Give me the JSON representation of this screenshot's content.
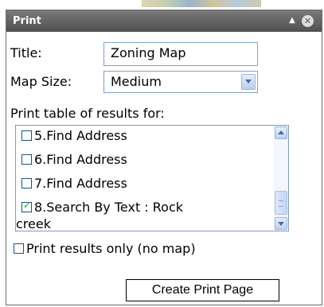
{
  "window": {
    "title": "Print"
  },
  "form": {
    "title_label": "Title:",
    "title_value": "Zoning Map",
    "map_size_label": "Map Size:",
    "map_size_value": "Medium",
    "print_table_label": "Print table of results for:"
  },
  "results_list": {
    "items": [
      {
        "label": "5.Find Address",
        "checked": false
      },
      {
        "label": "6.Find Address",
        "checked": false
      },
      {
        "label": "7.Find Address",
        "checked": false
      },
      {
        "label": "8.Search By Text : Rock",
        "label_cont": "creek",
        "checked": true
      }
    ]
  },
  "options": {
    "print_results_only_label": "Print results only (no map)",
    "print_results_only_checked": false
  },
  "actions": {
    "create_print_page_label": "Create Print Page"
  },
  "icons": {
    "collapse": "collapse-icon",
    "close": "close-icon",
    "dropdown": "chevron-down-icon",
    "scroll_up": "scroll-up-icon",
    "scroll_down": "scroll-down-icon"
  },
  "colors": {
    "titlebar": "#5f5f5f",
    "input_border": "#7fa0c8",
    "checkmark": "#22a022"
  }
}
